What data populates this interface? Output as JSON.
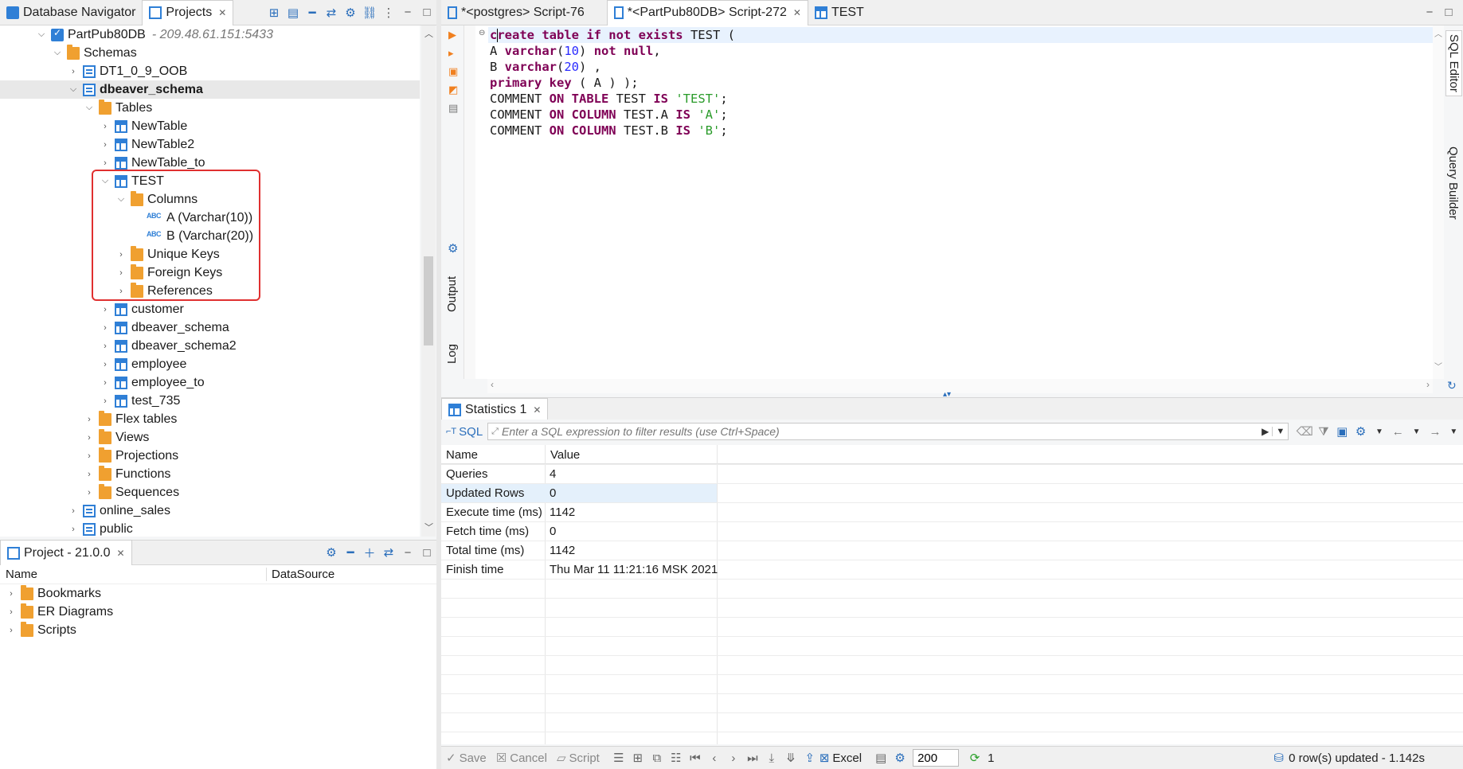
{
  "top_tabs": {
    "db_navigator": "Database Navigator",
    "projects": "Projects",
    "close": "☒"
  },
  "tree": {
    "connection": {
      "label": "PartPub80DB",
      "host": "- 209.48.61.151:5433"
    },
    "schemas": "Schemas",
    "items": [
      "DT1_0_9_OOB",
      "dbeaver_schema",
      "Tables",
      "NewTable",
      "NewTable2",
      "NewTable_to",
      "TEST",
      "Columns",
      "A (Varchar(10))",
      "B (Varchar(20))",
      "Unique Keys",
      "Foreign Keys",
      "References",
      "customer",
      "dbeaver_schema",
      "dbeaver_schema2",
      "employee",
      "employee_to",
      "test_735",
      "Flex tables",
      "Views",
      "Projections",
      "Functions",
      "Sequences",
      "online_sales",
      "public"
    ],
    "col_icon": "ABC"
  },
  "project_panel": {
    "title": "Project - 21.0.0",
    "col_name": "Name",
    "col_datasource": "DataSource",
    "items": [
      "Bookmarks",
      "ER Diagrams",
      "Scripts"
    ]
  },
  "editor_tabs": [
    {
      "label": "*<postgres> Script-76"
    },
    {
      "label": "*<PartPub80DB> Script-272"
    },
    {
      "label": "TEST"
    }
  ],
  "side_tabs": {
    "sql_editor": "SQL Editor",
    "query_builder": "Query Builder",
    "output": "Output",
    "log": "Log"
  },
  "code_lines": [
    [
      [
        "kw",
        "create table if not exists"
      ],
      [
        "plain",
        " TEST ("
      ]
    ],
    [
      [
        "plain",
        "A "
      ],
      [
        "kw",
        "varchar"
      ],
      [
        "plain",
        "("
      ],
      [
        "num",
        "10"
      ],
      [
        "plain",
        ") "
      ],
      [
        "kw",
        "not null"
      ],
      [
        "plain",
        ","
      ]
    ],
    [
      [
        "plain",
        "B "
      ],
      [
        "kw",
        "varchar"
      ],
      [
        "plain",
        "("
      ],
      [
        "num",
        "20"
      ],
      [
        "plain",
        ") ,"
      ]
    ],
    [
      [
        "kw",
        "primary key"
      ],
      [
        "plain",
        " ( A ) );"
      ]
    ],
    [
      [
        "plain",
        "COMMENT "
      ],
      [
        "kw",
        "ON TABLE"
      ],
      [
        "plain",
        " TEST "
      ],
      [
        "kw",
        "IS"
      ],
      [
        "plain",
        " "
      ],
      [
        "str",
        "'TEST'"
      ],
      [
        "plain",
        ";"
      ]
    ],
    [
      [
        "plain",
        "COMMENT "
      ],
      [
        "kw",
        "ON COLUMN"
      ],
      [
        "plain",
        " TEST.A "
      ],
      [
        "kw",
        "IS"
      ],
      [
        "plain",
        " "
      ],
      [
        "str",
        "'A'"
      ],
      [
        "plain",
        ";"
      ]
    ],
    [
      [
        "plain",
        "COMMENT "
      ],
      [
        "kw",
        "ON COLUMN"
      ],
      [
        "plain",
        " TEST.B "
      ],
      [
        "kw",
        "IS"
      ],
      [
        "plain",
        " "
      ],
      [
        "str",
        "'B'"
      ],
      [
        "plain",
        ";"
      ]
    ]
  ],
  "results": {
    "tab_label": "Statistics 1",
    "sql_label": "SQL",
    "filter_placeholder": "Enter a SQL expression to filter results (use Ctrl+Space)",
    "col_name": "Name",
    "col_value": "Value",
    "rows": [
      {
        "name": "Queries",
        "value": "4"
      },
      {
        "name": "Updated Rows",
        "value": "0"
      },
      {
        "name": "Execute time (ms)",
        "value": "1142"
      },
      {
        "name": "Fetch time (ms)",
        "value": "0"
      },
      {
        "name": "Total time (ms)",
        "value": "1142"
      },
      {
        "name": "Finish time",
        "value": "Thu Mar 11 11:21:16 MSK 2021"
      }
    ]
  },
  "status_bar": {
    "save": "Save",
    "cancel": "Cancel",
    "script": "Script",
    "excel": "Excel",
    "fetch_size": "200",
    "refresh_count": "1",
    "status_text": "0 row(s) updated - 1.142s"
  },
  "colors": {
    "keyword": "#7f0055",
    "string": "#2a9b2a",
    "number": "#2a2aff",
    "highlight_box": "#e03030",
    "accent": "#2f7fd6"
  }
}
